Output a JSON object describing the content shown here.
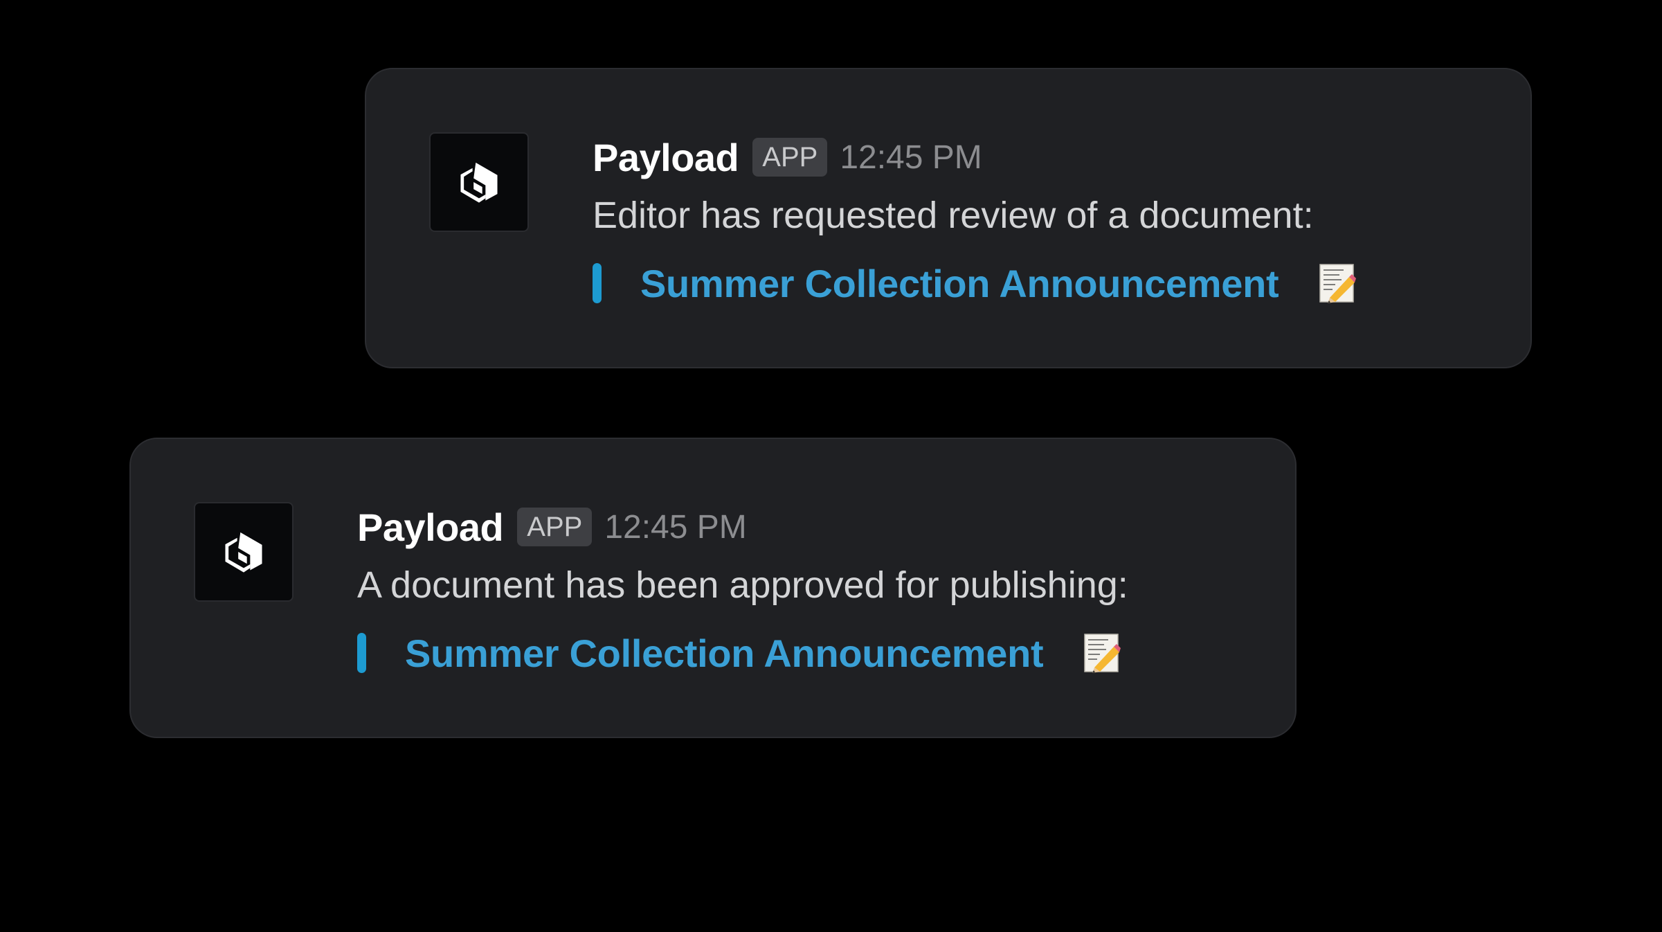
{
  "messages": [
    {
      "sender": "Payload",
      "badge": "APP",
      "time": "12:45 PM",
      "text": "Editor has requested review of a document:",
      "attachment": {
        "title": "Summer Collection Announcement",
        "icon": "memo-icon"
      }
    },
    {
      "sender": "Payload",
      "badge": "APP",
      "time": "12:45 PM",
      "text": "A document has been approved for publishing:",
      "attachment": {
        "title": "Summer Collection Announcement",
        "icon": "memo-icon"
      }
    }
  ],
  "colors": {
    "background": "#000000",
    "card": "#1f2023",
    "link": "#3aa0d6",
    "accent_bar": "#1d9bd1"
  }
}
